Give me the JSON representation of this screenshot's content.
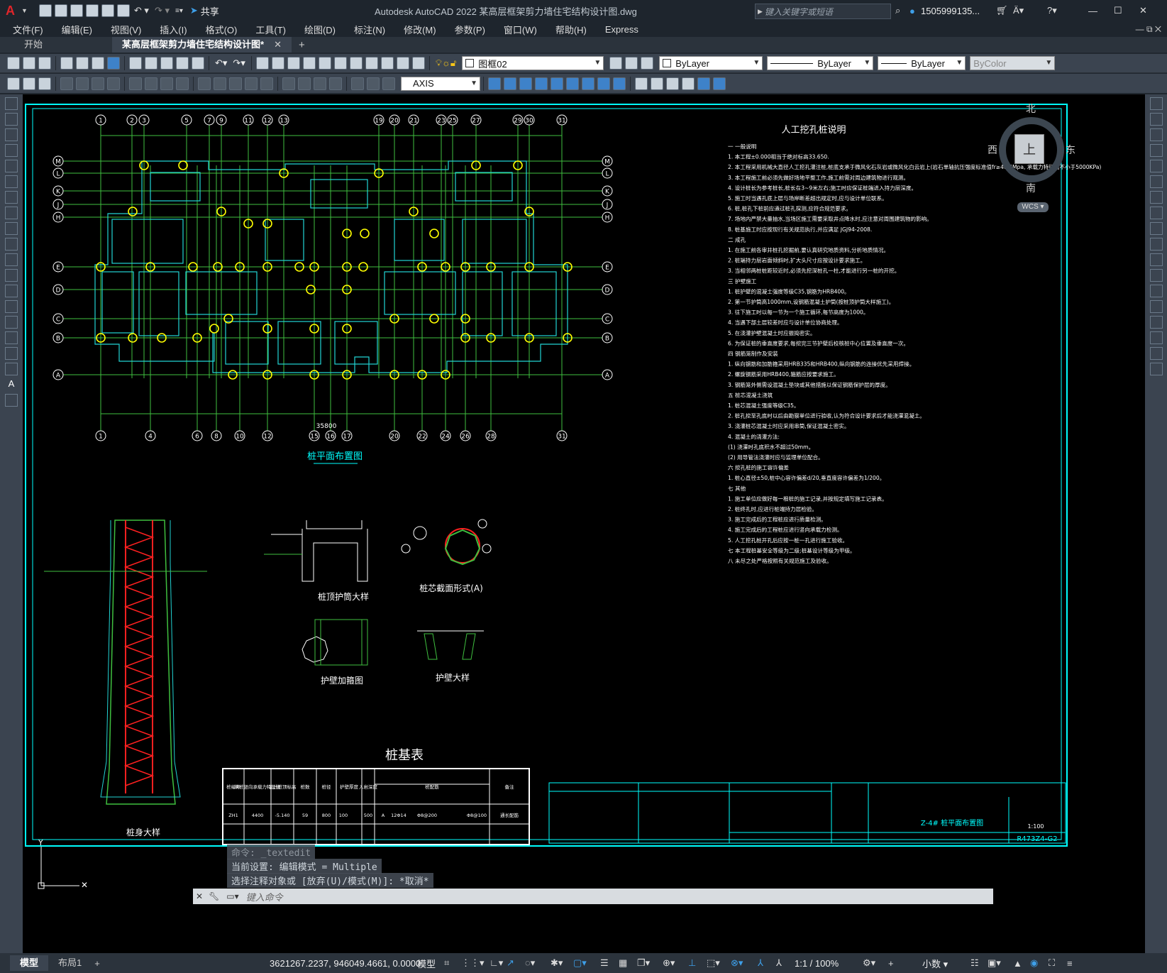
{
  "window": {
    "title": "Autodesk AutoCAD 2022    某高层框架剪力墙住宅结构设计图.dwg",
    "share_label": "共享",
    "search_placeholder": "键入关键字或短语",
    "user": "1505999135...",
    "min": "—",
    "max": "☐",
    "close": "✕"
  },
  "menu": [
    "文件(F)",
    "编辑(E)",
    "视图(V)",
    "插入(I)",
    "格式(O)",
    "工具(T)",
    "绘图(D)",
    "标注(N)",
    "修改(M)",
    "参数(P)",
    "窗口(W)",
    "帮助(H)",
    "Express"
  ],
  "doc_tabs": {
    "start": "开始",
    "active": "某高层框架剪力墙住宅结构设计图*",
    "close": "✕",
    "add": "+"
  },
  "toolbar": {
    "layer": "图框02",
    "color": "ByLayer",
    "linetype": "ByLayer",
    "lineweight": "ByLayer",
    "plotstyle": "ByColor",
    "axis_dd": "AXIS"
  },
  "viewcube": {
    "north": "北",
    "south": "南",
    "east": "东",
    "west": "西",
    "top": "上",
    "wcs": "WCS"
  },
  "drawing": {
    "plan_title": "桩平面布置图",
    "notes_title": "人工挖孔桩说明",
    "detail1": "桩身大样",
    "detail2": "桩顶护筒大样",
    "detail3": "桩芯截面形式(A)",
    "detail4": "护壁加箍图",
    "detail5": "护壁大样",
    "pile_table_title": "桩基表",
    "total_dim": "35800",
    "top_axes": [
      "1",
      "2",
      "3",
      "5",
      "7",
      "9",
      "11",
      "12",
      "13",
      "19",
      "20",
      "21",
      "23",
      "25",
      "27",
      "29",
      "30",
      "31"
    ],
    "bottom_axes": [
      "1",
      "4",
      "6",
      "8",
      "10",
      "12",
      "15",
      "16",
      "17",
      "20",
      "22",
      "24",
      "26",
      "28",
      "31"
    ],
    "side_axes": [
      "M",
      "L",
      "K",
      "J",
      "H",
      "E",
      "D",
      "C",
      "B",
      "A"
    ],
    "notes": [
      "一 一般说明",
      "1. 本工程±0.000相当于绝对标高33.650.",
      "2. 本工程采用机械大直径人工挖孔灌注桩,桩底支承于微风化石灰岩或微风化白云岩上(岩石单轴抗压强度标准值fr≥40.4Mpa, 承载力特征值不小于5000KPa)",
      "3. 本工程施工前必须先做好场地平整工作,施工前需对周边建筑物进行观测。",
      "4. 设计桩长为参考桩长,桩长在3~9米左右;施工时应保证桩端进入持力层深度。",
      "5. 施工时当遇孔底上层与场岸断差超出规定时,应与设计单位联系。",
      "6. 桩,桩孔下桩前应通过桩孔探测,应符合规范要求。",
      "7. 场地内严禁大量抽水,当场区施工需要采取井点降水时,应注意对周围建筑物的影响。",
      "8. 桩基施工时应按现行有关规范执行,并应满足 JGJ94-2008.",
      "二 成孔",
      "1. 在施工前各审井桩孔挖掘前,要认真研究地质资料,分析地质情况。",
      "2. 桩端持力层岩面倾斜时,扩大头尺寸应按设计要求施工。",
      "3. 当相邻两桩桩距较近时,必须先挖深桩孔一柱,才能进行另一桩的开挖。",
      "三 护壁施工",
      "1. 桩护壁的混凝土强度等级C35,钢筋为HRB400。",
      "2. 第一节护筒高1000mm,设钢筋混凝土护筒(按桩顶护筒大样施工)。",
      "3. 往下施工时以每一节为一个施工循环,每节高度为1000。",
      "4. 当遇下部土层较差时应与设计单位协商处理。",
      "5. 在浇灌护壁混凝土时应振捣密实。",
      "6. 为保证桩的垂直度要求,每挖完三节护壁后校核桩中心位置及垂直度一次。",
      "四 钢筋笼制作及安装",
      "1. 纵向钢筋和加筋箍采用HRB335和HRB400,纵向钢筋的连接优先采用焊接。",
      "2. 螺旋钢筋采用HRB400,箍筋应按要求施工。",
      "3. 钢筋笼外侧需设混凝土垫块或其他措施以保证钢筋保护层的厚度。",
      "五 桩芯混凝土浇筑",
      "1. 桩芯混凝土强度等级C35。",
      "2. 桩孔挖至孔底时以后由勘察单位进行验收,认为符合设计要求后才能浇灌混凝土。",
      "3. 浇灌桩芯混凝土时应采用串筒,保证混凝土密实。",
      "4. 混凝土的浇灌方法:",
      "(1) 浇灌时孔底积水不超过50mm。",
      "(2) 用导管法浇灌时应与监理单位配合。",
      "六 挖孔桩的施工容许偏差",
      "1. 桩心直径±50,桩中心容许偏差d/20,垂直度容许偏差为1/200。",
      "七 其他",
      "1. 施工单位应做好每一根桩的施工记录,并按规定填写施工记录表。",
      "2. 桩终孔时,应进行桩端持力层检验。",
      "3. 施工完成后的工程桩应进行质量检测。",
      "4. 施工完成后的工程桩应进行竖向承载力检测。",
      "5. 人工挖孔桩开孔后应按一桩一孔进行施工验收。",
      "七 本工程桩基安全等级为二级;桩基设计等级为甲级。",
      "八 未尽之处严格按照有关规范施工及验收。"
    ],
    "table": {
      "headers": [
        "桩编号",
        "单桩竖向承载力特征值",
        "设计桩顶标高",
        "桩数",
        "桩径",
        "护壁厚度",
        "入岩深度",
        "桩配筋",
        "备注"
      ],
      "sub": [
        "(kN)",
        "扩底形式",
        "①",
        "③",
        "②"
      ],
      "row": [
        "ZH1",
        "4400",
        "-5.140",
        "59",
        "800",
        "100",
        "500",
        "A",
        "12Φ14",
        "Φ8@200",
        "Φ8@100",
        "通长配筋"
      ]
    },
    "titleblock": {
      "drawing_no": "Z-4#  桩平面布置图",
      "code": "R473Z4-G2",
      "scale": "1:100"
    }
  },
  "command": {
    "line1": "命令: _textedit",
    "line2": "当前设置: 编辑模式 = Multiple",
    "line3": "选择注释对象或 [放弃(U)/模式(M)]: *取消*",
    "placeholder": "键入命令"
  },
  "status": {
    "model_tab": "模型",
    "layout_tab": "布局1",
    "add": "+",
    "coords": "3621267.2237, 946049.4661, 0.0000",
    "space": "模型",
    "scale": "1:1 / 100%",
    "units": "小数"
  }
}
